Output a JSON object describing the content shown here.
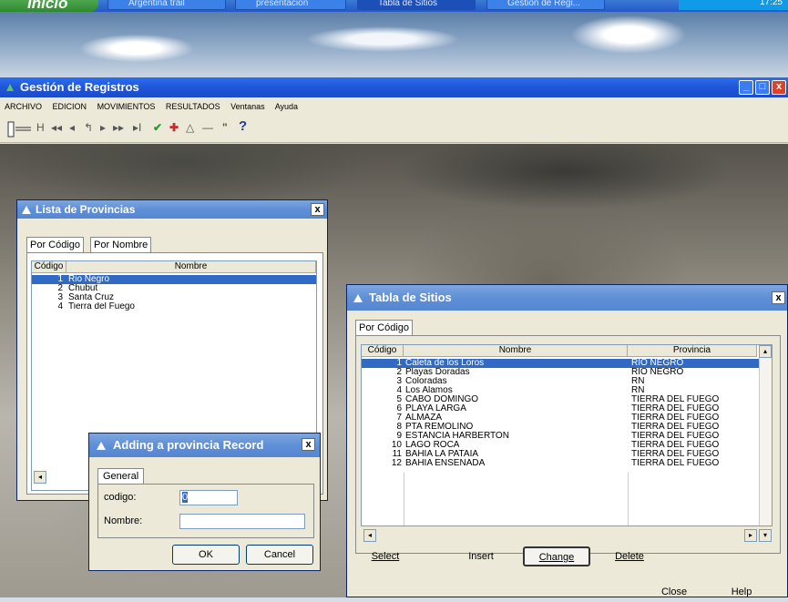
{
  "taskbar": {
    "start_label": "Inicio",
    "buttons": [
      "Argentina trail",
      "presentación",
      "Tabla de Sitios",
      "Gestión de Regi..."
    ],
    "tray_time": "17:25"
  },
  "app": {
    "title": "Gestión de Registros",
    "window_controls": [
      "_",
      "□",
      "x"
    ],
    "menu": [
      "ARCHIVO",
      "EDICION",
      "MOVIMIENTOS",
      "RESULTADOS",
      "Ventanas",
      "Ayuda"
    ],
    "toolbar_glyphs": [
      "H",
      "◂◂",
      "◂",
      "↰",
      "▸",
      "▸▸",
      "▸I",
      "✔",
      "✚",
      "△",
      "—",
      "\"",
      "?"
    ]
  },
  "provincias": {
    "title": "Lista de Provincias",
    "close": "x",
    "tabs": [
      "Por Código",
      "Por Nombre"
    ],
    "columns": [
      "Código",
      "Nombre"
    ],
    "rows": [
      {
        "codigo": "1",
        "nombre": "Rio Negro"
      },
      {
        "codigo": "2",
        "nombre": "Chubut"
      },
      {
        "codigo": "3",
        "nombre": "Santa Cruz"
      },
      {
        "codigo": "4",
        "nombre": "Tierra del Fuego"
      }
    ],
    "selected_row": 0,
    "scroll_left": "◂"
  },
  "adding": {
    "title": "Adding a provincia Record",
    "close": "x",
    "tab": "General",
    "labels": {
      "codigo": "codigo:",
      "nombre": "Nombre:"
    },
    "values": {
      "codigo": "0",
      "nombre": ""
    },
    "ok": "OK",
    "cancel": "Cancel"
  },
  "sitios": {
    "title": "Tabla de Sitios",
    "close": "x",
    "tab": "Por Código",
    "columns": [
      "Código",
      "Nombre",
      "Provincia"
    ],
    "rows": [
      {
        "codigo": "1",
        "nombre": "Caleta de los Loros",
        "provincia": "RIO NEGRO"
      },
      {
        "codigo": "2",
        "nombre": "Playas Doradas",
        "provincia": "RIO NEGRO"
      },
      {
        "codigo": "3",
        "nombre": "Coloradas",
        "provincia": "RN"
      },
      {
        "codigo": "4",
        "nombre": "Los Alamos",
        "provincia": "RN"
      },
      {
        "codigo": "5",
        "nombre": "CABO DOMINGO",
        "provincia": "TIERRA DEL FUEGO"
      },
      {
        "codigo": "6",
        "nombre": "PLAYA LARGA",
        "provincia": "TIERRA DEL FUEGO"
      },
      {
        "codigo": "7",
        "nombre": "ALMAZA",
        "provincia": "TIERRA DEL FUEGO"
      },
      {
        "codigo": "8",
        "nombre": "PTA REMOLINO",
        "provincia": "TIERRA DEL FUEGO"
      },
      {
        "codigo": "9",
        "nombre": "ESTANCIA HARBERTON",
        "provincia": "TIERRA DEL FUEGO"
      },
      {
        "codigo": "10",
        "nombre": "LAGO ROCA",
        "provincia": "TIERRA DEL FUEGO"
      },
      {
        "codigo": "11",
        "nombre": "BAHIA LA PATAIA",
        "provincia": "TIERRA DEL FUEGO"
      },
      {
        "codigo": "12",
        "nombre": "BAHIA ENSENADA",
        "provincia": "TIERRA DEL FUEGO"
      }
    ],
    "selected_row": 0,
    "buttons": {
      "select": "Select",
      "insert": "Insert",
      "change": "Change",
      "delete": "Delete",
      "close": "Close",
      "help": "Help"
    },
    "scroll": {
      "left": "◂",
      "right": "▸",
      "up": "▴",
      "down": "▾"
    }
  },
  "colors": {
    "selection": "#316ac5",
    "titlebar": "#2055d8",
    "dialog_titlebar": "#5f8fd6"
  }
}
